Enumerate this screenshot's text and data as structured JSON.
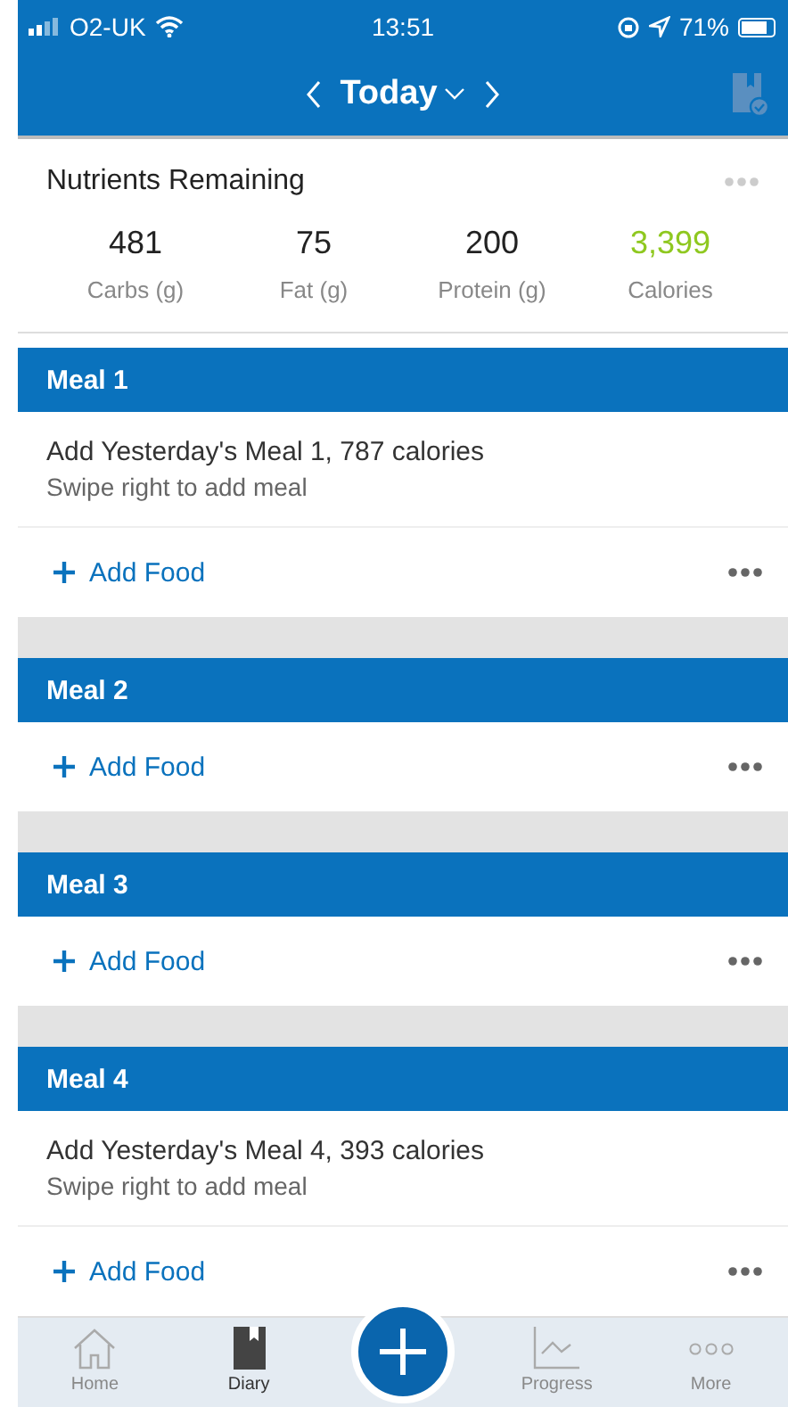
{
  "status_bar": {
    "carrier": "O2-UK",
    "time": "13:51",
    "battery": "71%"
  },
  "nav": {
    "title": "Today"
  },
  "nutrients": {
    "title": "Nutrients Remaining",
    "items": [
      {
        "value": "481",
        "label": "Carbs (g)",
        "highlight": false
      },
      {
        "value": "75",
        "label": "Fat (g)",
        "highlight": false
      },
      {
        "value": "200",
        "label": "Protein (g)",
        "highlight": false
      },
      {
        "value": "3,399",
        "label": "Calories",
        "highlight": true
      }
    ]
  },
  "meals": [
    {
      "name": "Meal 1",
      "suggestion": {
        "text": "Add Yesterday's Meal 1, 787 calories",
        "hint": "Swipe right to add meal"
      },
      "add_label": "Add Food"
    },
    {
      "name": "Meal 2",
      "add_label": "Add Food"
    },
    {
      "name": "Meal 3",
      "add_label": "Add Food"
    },
    {
      "name": "Meal 4",
      "suggestion": {
        "text": "Add Yesterday's Meal 4, 393 calories",
        "hint": "Swipe right to add meal"
      },
      "add_label": "Add Food"
    }
  ],
  "tab_bar": [
    {
      "kind": "home",
      "label": "Home",
      "selected": false
    },
    {
      "kind": "diary",
      "label": "Diary",
      "selected": true
    },
    {
      "kind": "add"
    },
    {
      "kind": "progress",
      "label": "Progress",
      "selected": false
    },
    {
      "kind": "more",
      "label": "More",
      "selected": false
    }
  ]
}
